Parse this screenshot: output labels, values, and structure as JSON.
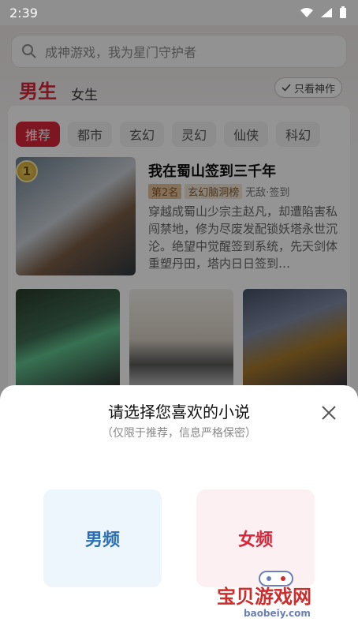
{
  "status": {
    "time": "2:39"
  },
  "search": {
    "placeholder": "成神游戏，我为星门守护者"
  },
  "tabs": {
    "male": "男生",
    "female": "女生",
    "only_good": "只看神作"
  },
  "categories": [
    "推荐",
    "都市",
    "玄幻",
    "灵幻",
    "仙侠",
    "科幻"
  ],
  "book": {
    "rank_badge": "1",
    "title": "我在蜀山签到三千年",
    "rank_tag": "第2名",
    "category_tag": "玄幻脑洞榜",
    "genre": "无敌·签到",
    "desc": "穿越成蜀山少宗主赵凡，却遭陷害私闯禁地，修为尽废发配锁妖塔永世沉沦。绝望中觉醒签到系统，先天剑体重塑丹田，塔内日日签到…"
  },
  "sheet": {
    "title": "请选择您喜欢的小说",
    "subtitle": "（仅限于推荐，信息严格保密）",
    "male": "男频",
    "female": "女频"
  },
  "watermark": {
    "text": "宝贝游戏网",
    "url": "baobeiy.com"
  },
  "colors": {
    "accent": "#d7273a",
    "male_blue": "#2d6fb4"
  }
}
